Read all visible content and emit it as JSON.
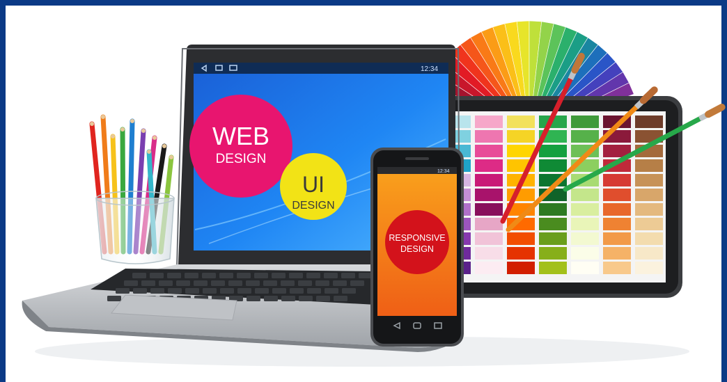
{
  "laptop": {
    "status_time": "12:34",
    "bubble_web": {
      "line1": "WEB",
      "line2": "DESIGN",
      "color": "#e8156f"
    },
    "bubble_ui": {
      "line1": "UI",
      "line2": "DESIGN",
      "color": "#f2e316"
    },
    "screen_color": "#1d7ff0"
  },
  "phone": {
    "status_time": "12:34",
    "bubble": {
      "line1": "RESPONSIVE",
      "line2": "DESIGN",
      "color": "#d3121b"
    },
    "screen_color": "#f3811a"
  },
  "palette_colors": [
    [
      "#2b1b3d",
      "#b8e4ec",
      "#f6a7c9",
      "#f2e15c",
      "#27a64b",
      "#3f9a3a",
      "#6b1430",
      "#6e3c2a"
    ],
    [
      "#3d2a5e",
      "#7fd1e0",
      "#ee76b0",
      "#f5d426",
      "#2fb452",
      "#56b14a",
      "#8b1a3b",
      "#8a5232"
    ],
    [
      "#1f3d80",
      "#49b8d4",
      "#e84b98",
      "#ffd500",
      "#14a03f",
      "#6ec057",
      "#a3203f",
      "#a46a3c"
    ],
    [
      "#2255a8",
      "#1fa3c9",
      "#dd2b86",
      "#ffc400",
      "#0f8a35",
      "#8ccf5f",
      "#c02a3a",
      "#b67f47"
    ],
    [
      "#5a2f8f",
      "#d6b6e3",
      "#c91a77",
      "#ffb300",
      "#0c7530",
      "#a8db73",
      "#d63a33",
      "#c79257"
    ],
    [
      "#7b2b94",
      "#c48fd6",
      "#a8136b",
      "#ff9c00",
      "#116329",
      "#c4e68b",
      "#e04e2d",
      "#d8a66a"
    ],
    [
      "#9c2f96",
      "#b070c9",
      "#880f5c",
      "#ff8400",
      "#2e7a22",
      "#d9ee9f",
      "#e8672b",
      "#e4b97f"
    ],
    [
      "#b6338e",
      "#9b55bd",
      "#e7a6c6",
      "#ff6a00",
      "#4a8c1f",
      "#e9f5b8",
      "#ef8232",
      "#edcb95"
    ],
    [
      "#c8306f",
      "#8639ae",
      "#f1c3d8",
      "#f24d00",
      "#6a9e1c",
      "#f3f9d1",
      "#f29a48",
      "#f3dcae"
    ],
    [
      "#d43053",
      "#6f2a9c",
      "#f8dde8",
      "#e53300",
      "#87af1a",
      "#fbfde8",
      "#f5b267",
      "#f7e8c8"
    ],
    [
      "#de3a3a",
      "#5a218a",
      "#fcecf2",
      "#d21e00",
      "#a3c01a",
      "#fffef4",
      "#f8c98b",
      "#fbf2de"
    ]
  ],
  "fan_colors": [
    "#7a0f2e",
    "#a3132d",
    "#c8162b",
    "#e21b25",
    "#f0341d",
    "#f5561a",
    "#f97a17",
    "#fb9c16",
    "#fbbf18",
    "#f9d91e",
    "#e7e52a",
    "#bfe03a",
    "#93d34a",
    "#5cc35a",
    "#2bb06c",
    "#1b9e86",
    "#1a86a1",
    "#1d6fbb",
    "#2a55c7",
    "#4441bd",
    "#6236ac",
    "#80309a"
  ],
  "pencil_colors": [
    "#e0251f",
    "#f07c1a",
    "#f6c21b",
    "#3aa83f",
    "#1f7fd0",
    "#7a3fb0",
    "#d92d89",
    "#1a1a1a",
    "#35b6c9",
    "#8bc53f"
  ],
  "brushes": [
    {
      "handle": "#d61f2b",
      "bristle": "#c0773a"
    },
    {
      "handle": "#f08a16",
      "bristle": "#b86a33"
    },
    {
      "handle": "#27a84a",
      "bristle": "#c27a3a"
    }
  ]
}
